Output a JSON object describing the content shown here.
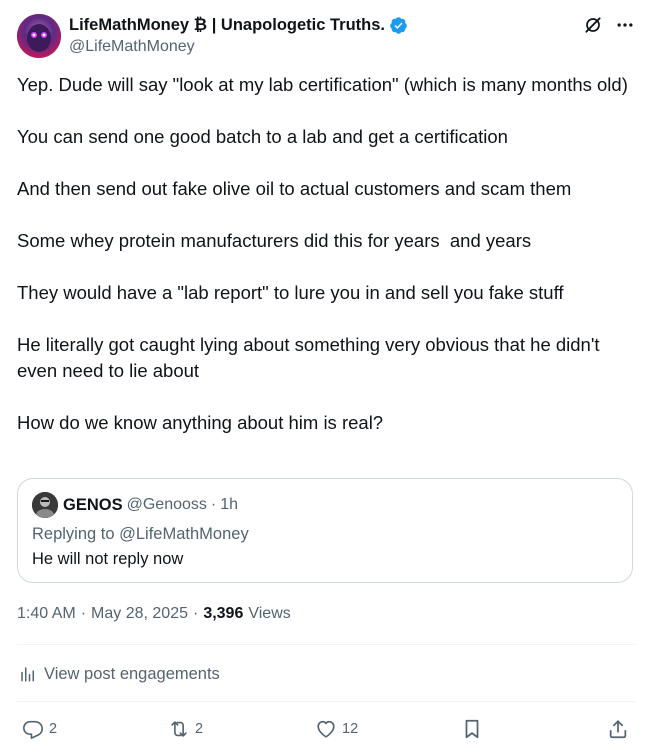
{
  "author": {
    "display_name": "LifeMathMoney ₿ | Unapologetic Truths.",
    "handle": "@LifeMathMoney",
    "verified": true,
    "badge_color": "#1d9bf0"
  },
  "header_icons": [
    "grok-icon",
    "more-icon"
  ],
  "post": {
    "paragraphs": [
      "Yep. Dude will say \"look at my lab certification\" (which is many months old)",
      "You can send one good batch to a lab and get a certification",
      "And then send out fake olive oil to actual customers and scam them",
      "Some whey protein manufacturers did this for years  and years",
      "They would have a \"lab report\" to lure you in and sell you fake stuff",
      "He literally got caught lying about something very obvious that he didn't even need to lie about",
      "How do we know anything about him is real?"
    ]
  },
  "quote": {
    "name": "GENOS",
    "handle": "@Genooss",
    "dot": "·",
    "time": "1h",
    "replying_to": "Replying to @LifeMathMoney",
    "text": "He will not reply now"
  },
  "meta": {
    "time": "1:40 AM",
    "dot1": "·",
    "date": "May 28, 2025",
    "dot2": "·",
    "views_count": "3,396",
    "views_label": "Views"
  },
  "engagements": {
    "label": "View post engagements"
  },
  "actions": {
    "replies": "2",
    "reposts": "2",
    "likes": "12"
  },
  "colors": {
    "text": "#0f1419",
    "secondary": "#536471",
    "border": "#cfd9de",
    "divider": "#eff3f4"
  }
}
